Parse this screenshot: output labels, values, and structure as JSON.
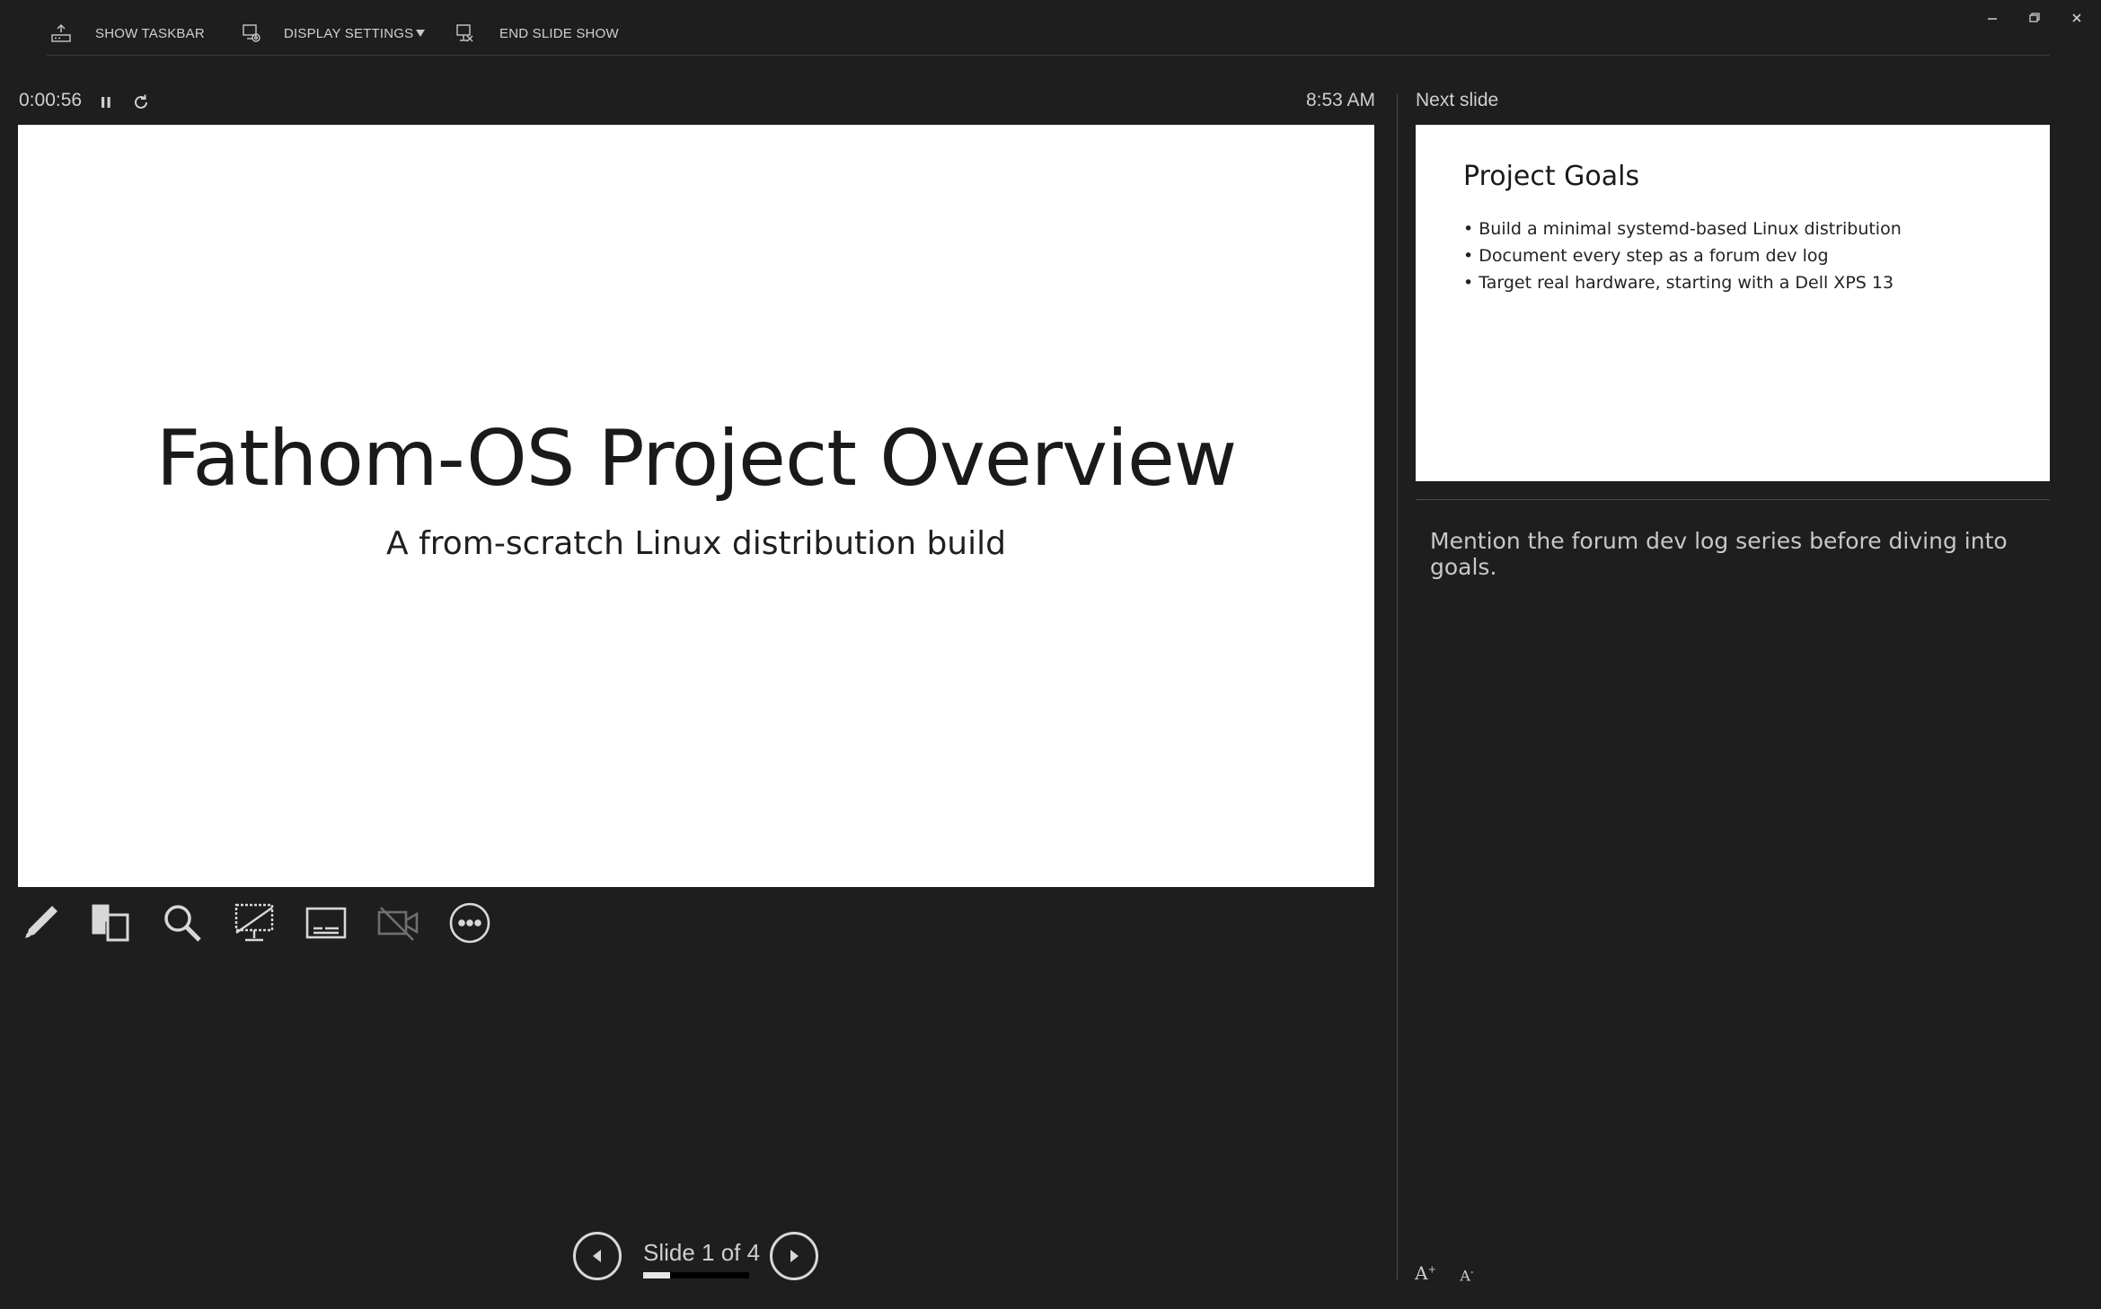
{
  "toolbar": {
    "show_taskbar": "SHOW TASKBAR",
    "display_settings": "DISPLAY SETTINGS",
    "end_slide_show": "END SLIDE SHOW"
  },
  "timer": {
    "elapsed": "0:00:56",
    "clock": "8:53 AM"
  },
  "current_slide": {
    "title": "Fathom-OS Project Overview",
    "subtitle": "A from-scratch Linux distribution build"
  },
  "tools": [
    "pen-icon",
    "see-all-slides-icon",
    "zoom-icon",
    "black-screen-icon",
    "subtitles-icon",
    "camera-off-icon",
    "more-options-icon"
  ],
  "navigation": {
    "label": "Slide 1 of 4",
    "current": 1,
    "total": 4
  },
  "next_slide": {
    "label": "Next slide",
    "title": "Project Goals",
    "bullets": [
      "Build a minimal systemd-based Linux distribution",
      "Document every step as a forum dev log",
      "Target real hardware, starting with a Dell XPS 13"
    ]
  },
  "notes": "Mention the forum dev log series before diving into goals.",
  "colors": {
    "background": "#1e1e1e",
    "text": "#d6d6d6",
    "slide": "#ffffff"
  }
}
